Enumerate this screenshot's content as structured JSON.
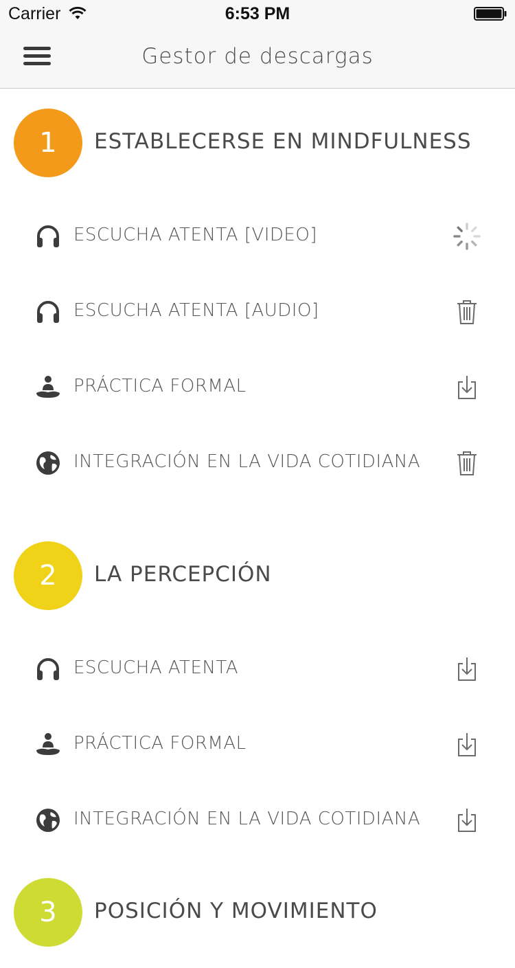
{
  "status_bar": {
    "carrier": "Carrier",
    "time": "6:53 PM"
  },
  "nav": {
    "title": "Gestor de descargas"
  },
  "colors": {
    "section1": "#f49a1b",
    "section2": "#f0d318",
    "section3": "#cedb33"
  },
  "sections": [
    {
      "number": "1",
      "title": "ESTABLECERSE EN MINDFULNESS",
      "items": [
        {
          "icon": "headphones-icon",
          "label": "ESCUCHA ATENTA [VIDEO]",
          "action": "loading-spinner-icon"
        },
        {
          "icon": "headphones-icon",
          "label": "ESCUCHA ATENTA [AUDIO]",
          "action": "trash-icon"
        },
        {
          "icon": "meditation-icon",
          "label": "PRÁCTICA FORMAL",
          "action": "download-icon"
        },
        {
          "icon": "globe-icon",
          "label": "INTEGRACIÓN EN LA VIDA COTIDIANA",
          "action": "trash-icon"
        }
      ]
    },
    {
      "number": "2",
      "title": "LA PERCEPCIÓN",
      "items": [
        {
          "icon": "headphones-icon",
          "label": "ESCUCHA ATENTA",
          "action": "download-icon"
        },
        {
          "icon": "meditation-icon",
          "label": "PRÁCTICA FORMAL",
          "action": "download-icon"
        },
        {
          "icon": "globe-icon",
          "label": "INTEGRACIÓN EN LA VIDA COTIDIANA",
          "action": "download-icon"
        }
      ]
    },
    {
      "number": "3",
      "title": "POSICIÓN Y MOVIMIENTO",
      "items": []
    }
  ]
}
